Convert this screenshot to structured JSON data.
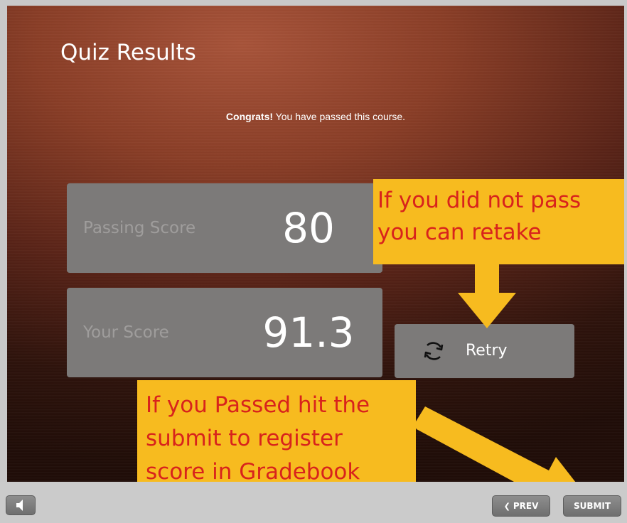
{
  "quiz": {
    "title": "Quiz Results",
    "congrats_bold": "Congrats!",
    "congrats_text": " You have passed this course."
  },
  "scores": {
    "passing_label": "Passing Score",
    "passing_value": "80",
    "your_label": "Your Score",
    "your_value": "91.3"
  },
  "retry": {
    "label": "Retry",
    "icon": "refresh-icon"
  },
  "annotations": {
    "retake_line1": "If you did not pass",
    "retake_line2": "you can retake",
    "submit_line1": "If you Passed hit the",
    "submit_line2": "submit to register",
    "submit_line3": "score in Gradebook",
    "note_bg": "#f7bb1f",
    "note_text_color": "#d8231c",
    "arrow_color": "#f7bb1f"
  },
  "nav": {
    "prev_label": "PREV",
    "prev_icon": "chevron-left-icon",
    "submit_label": "SUBMIT",
    "audio_icon": "speaker-icon"
  }
}
